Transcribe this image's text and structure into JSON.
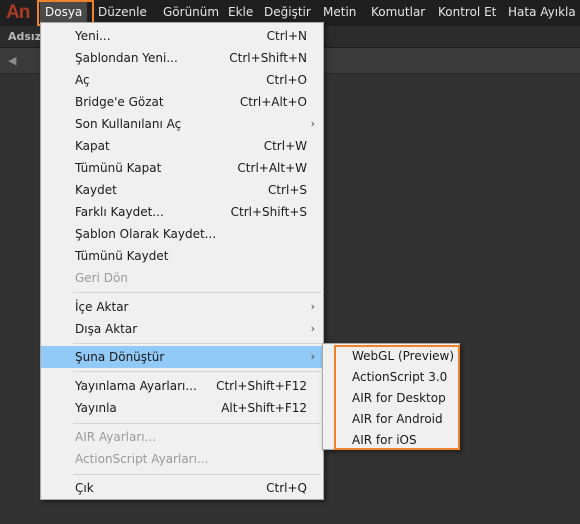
{
  "app": {
    "logo_text": "An",
    "accent_color": "#f0822a",
    "highlight_color": "#91c9f7"
  },
  "menubar": {
    "items": [
      {
        "label": "Dosya"
      },
      {
        "label": "Düzenle"
      },
      {
        "label": "Görünüm"
      },
      {
        "label": "Ekle"
      },
      {
        "label": "Değiştir"
      },
      {
        "label": "Metin"
      },
      {
        "label": "Komutlar"
      },
      {
        "label": "Kontrol Et"
      },
      {
        "label": "Hata Ayıkla"
      }
    ]
  },
  "document": {
    "tab_label": "Adsız",
    "back_icon": "arrow-left-icon"
  },
  "file_menu": {
    "items": [
      {
        "label": "Yeni...",
        "shortcut": "Ctrl+N"
      },
      {
        "label": "Şablondan Yeni...",
        "shortcut": "Ctrl+Shift+N"
      },
      {
        "label": "Aç",
        "shortcut": "Ctrl+O"
      },
      {
        "label": "Bridge'e Gözat",
        "shortcut": "Ctrl+Alt+O"
      },
      {
        "label": "Son Kullanılanı Aç",
        "submenu_icon": "chevron-right-icon",
        "arrow": "›"
      },
      {
        "label": "Kapat",
        "shortcut": "Ctrl+W"
      },
      {
        "label": "Tümünü Kapat",
        "shortcut": "Ctrl+Alt+W"
      },
      {
        "label": "Kaydet",
        "shortcut": "Ctrl+S"
      },
      {
        "label": "Farklı Kaydet...",
        "shortcut": "Ctrl+Shift+S"
      },
      {
        "label": "Şablon Olarak Kaydet..."
      },
      {
        "label": "Tümünü Kaydet"
      },
      {
        "label": "Geri Dön",
        "disabled": true
      },
      {
        "label": "İçe Aktar",
        "submenu_icon": "chevron-right-icon",
        "arrow": "›"
      },
      {
        "label": "Dışa Aktar",
        "submenu_icon": "chevron-right-icon",
        "arrow": "›"
      },
      {
        "label": "Şuna Dönüştür",
        "submenu_icon": "chevron-right-icon",
        "arrow": "›",
        "active": true
      },
      {
        "label": "Yayınlama Ayarları...",
        "shortcut": "Ctrl+Shift+F12"
      },
      {
        "label": "Yayınla",
        "shortcut": "Alt+Shift+F12"
      },
      {
        "label": "AIR Ayarları...",
        "disabled": true
      },
      {
        "label": "ActionScript Ayarları...",
        "disabled": true
      },
      {
        "label": "Çık",
        "shortcut": "Ctrl+Q"
      }
    ]
  },
  "convert_submenu": {
    "items": [
      {
        "label": "WebGL (Preview)"
      },
      {
        "label": "ActionScript 3.0"
      },
      {
        "label": "AIR for Desktop"
      },
      {
        "label": "AIR for Android"
      },
      {
        "label": "AIR for iOS"
      }
    ]
  }
}
